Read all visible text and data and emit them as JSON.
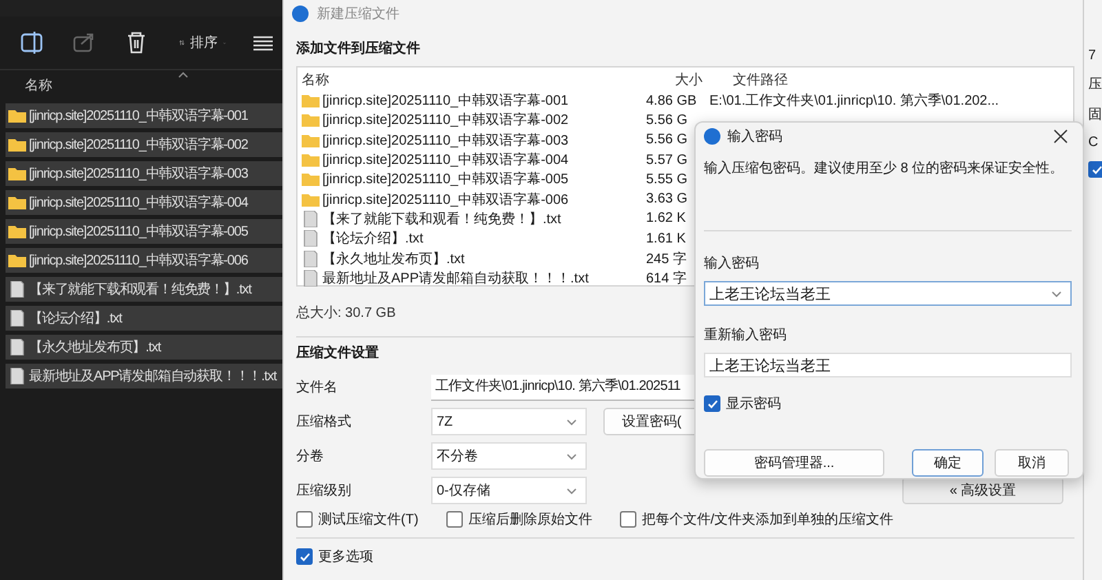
{
  "explorer": {
    "sort_label": "排序",
    "column": "名称",
    "items": [
      {
        "kind": "folder",
        "name": "[jinricp.site]20251110_中韩双语字幕-001",
        "selected": true
      },
      {
        "kind": "folder",
        "name": "[jinricp.site]20251110_中韩双语字幕-002",
        "selected": true
      },
      {
        "kind": "folder",
        "name": "[jinricp.site]20251110_中韩双语字幕-003",
        "selected": true
      },
      {
        "kind": "folder",
        "name": "[jinricp.site]20251110_中韩双语字幕-004",
        "selected": true
      },
      {
        "kind": "folder",
        "name": "[jinricp.site]20251110_中韩双语字幕-005",
        "selected": true
      },
      {
        "kind": "folder",
        "name": "[jinricp.site]20251110_中韩双语字幕-006",
        "selected": true
      },
      {
        "kind": "file",
        "name": "【来了就能下载和观看！纯免费！】.txt",
        "selected": true
      },
      {
        "kind": "file",
        "name": "【论坛介绍】.txt",
        "selected": true
      },
      {
        "kind": "file",
        "name": "【永久地址发布页】.txt",
        "selected": true
      },
      {
        "kind": "file",
        "name": "最新地址及APP请发邮箱自动获取！！！.txt",
        "selected": true
      }
    ]
  },
  "window": {
    "title": "新建压缩文件"
  },
  "add_section": {
    "title": "添加文件到压缩文件",
    "columns": [
      "名称",
      "大小",
      "文件路径"
    ],
    "rows": [
      {
        "kind": "folder",
        "name": "[jinricp.site]20251110_中韩双语字幕-001",
        "size": "4.86 GB",
        "path": "E:\\01.工作文件夹\\01.jinricp\\10. 第六季\\01.202..."
      },
      {
        "kind": "folder",
        "name": "[jinricp.site]20251110_中韩双语字幕-002",
        "size": "5.56 G"
      },
      {
        "kind": "folder",
        "name": "[jinricp.site]20251110_中韩双语字幕-003",
        "size": "5.56 G"
      },
      {
        "kind": "folder",
        "name": "[jinricp.site]20251110_中韩双语字幕-004",
        "size": "5.57 G"
      },
      {
        "kind": "folder",
        "name": "[jinricp.site]20251110_中韩双语字幕-005",
        "size": "5.55 G"
      },
      {
        "kind": "folder",
        "name": "[jinricp.site]20251110_中韩双语字幕-006",
        "size": "3.63 G"
      },
      {
        "kind": "file",
        "name": "【来了就能下载和观看！纯免费！】.txt",
        "size": "1.62 K"
      },
      {
        "kind": "file",
        "name": "【论坛介绍】.txt",
        "size": "1.61 K"
      },
      {
        "kind": "file",
        "name": "【永久地址发布页】.txt",
        "size": "245 字"
      },
      {
        "kind": "file",
        "name": "最新地址及APP请发邮箱自动获取！！！.txt",
        "size": "614 字"
      }
    ],
    "total": "总大小: 30.7 GB"
  },
  "settings": {
    "title": "压缩文件设置",
    "fields": [
      {
        "kind": "input",
        "label": "文件名",
        "value": "工作文件夹\\01.jinricp\\10. 第六季\\01.202511"
      },
      {
        "kind": "select",
        "label": "压缩格式",
        "value": "7Z"
      },
      {
        "kind": "select",
        "label": "分卷",
        "value": "不分卷"
      },
      {
        "kind": "select",
        "label": "压缩级别",
        "value": "0-仅存储"
      }
    ],
    "password_button": "设置密码(",
    "advanced_button": "« 高级设置",
    "checkboxes": [
      {
        "label": "测试压缩文件(T)",
        "checked": false
      },
      {
        "label": "压缩后删除原始文件",
        "checked": false
      },
      {
        "label": "把每个文件/文件夹添加到单独的压缩文件",
        "checked": false
      }
    ],
    "more_options": {
      "label": "更多选项",
      "checked": true
    }
  },
  "side_panel": {
    "texts": [
      "7",
      "压",
      "固",
      "C"
    ],
    "checked": true
  },
  "password_dialog": {
    "title": "输入密码",
    "message": "输入压缩包密码。建议使用至少 8 位的密码来保证安全性。",
    "password_label": "输入密码",
    "password": "上老王论坛当老王",
    "repeat_label": "重新输入密码",
    "repeat": "上老王论坛当老王",
    "show_password": {
      "label": "显示密码",
      "checked": true
    },
    "buttons": [
      {
        "label": "密码管理器...",
        "kind": "secondary"
      },
      {
        "label": "确定",
        "kind": "default"
      },
      {
        "label": "取消",
        "kind": "secondary"
      }
    ]
  }
}
